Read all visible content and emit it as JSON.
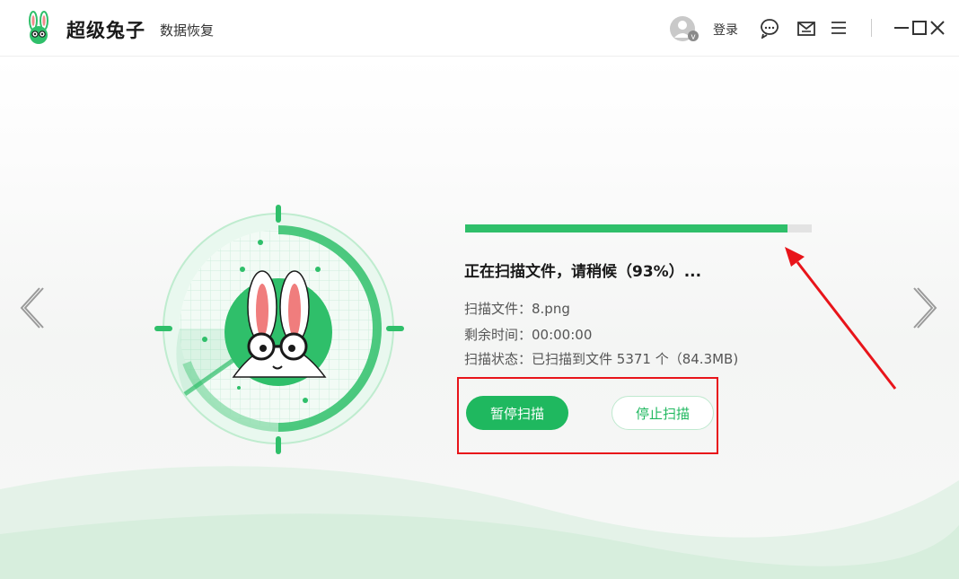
{
  "header": {
    "app_name": "超级兔子",
    "app_subtitle": "数据恢复",
    "login_label": "登录"
  },
  "icons": {
    "logo": "rabbit-logo-icon",
    "avatar": "user-avatar-icon",
    "support": "chat-support-icon",
    "feedback": "mail-feedback-icon",
    "menu": "hamburger-menu-icon",
    "minimize": "minimize-icon",
    "maximize": "maximize-icon",
    "close": "close-icon",
    "prev": "chevron-left-icon",
    "next": "chevron-right-icon"
  },
  "scan": {
    "progress": 0.93,
    "title": "正在扫描文件，请稍候（93%）...",
    "file_line": "扫描文件：8.png",
    "time_line": "剩余时间：00:00:00",
    "status_line": "扫描状态：已扫描到文件 5371 个（84.3MB)"
  },
  "buttons": {
    "pause": "暂停扫描",
    "stop": "停止扫描"
  },
  "colors": {
    "accent": "#1fb85f",
    "progress_track": "#e3e3e3",
    "annotation": "#e8141a"
  }
}
